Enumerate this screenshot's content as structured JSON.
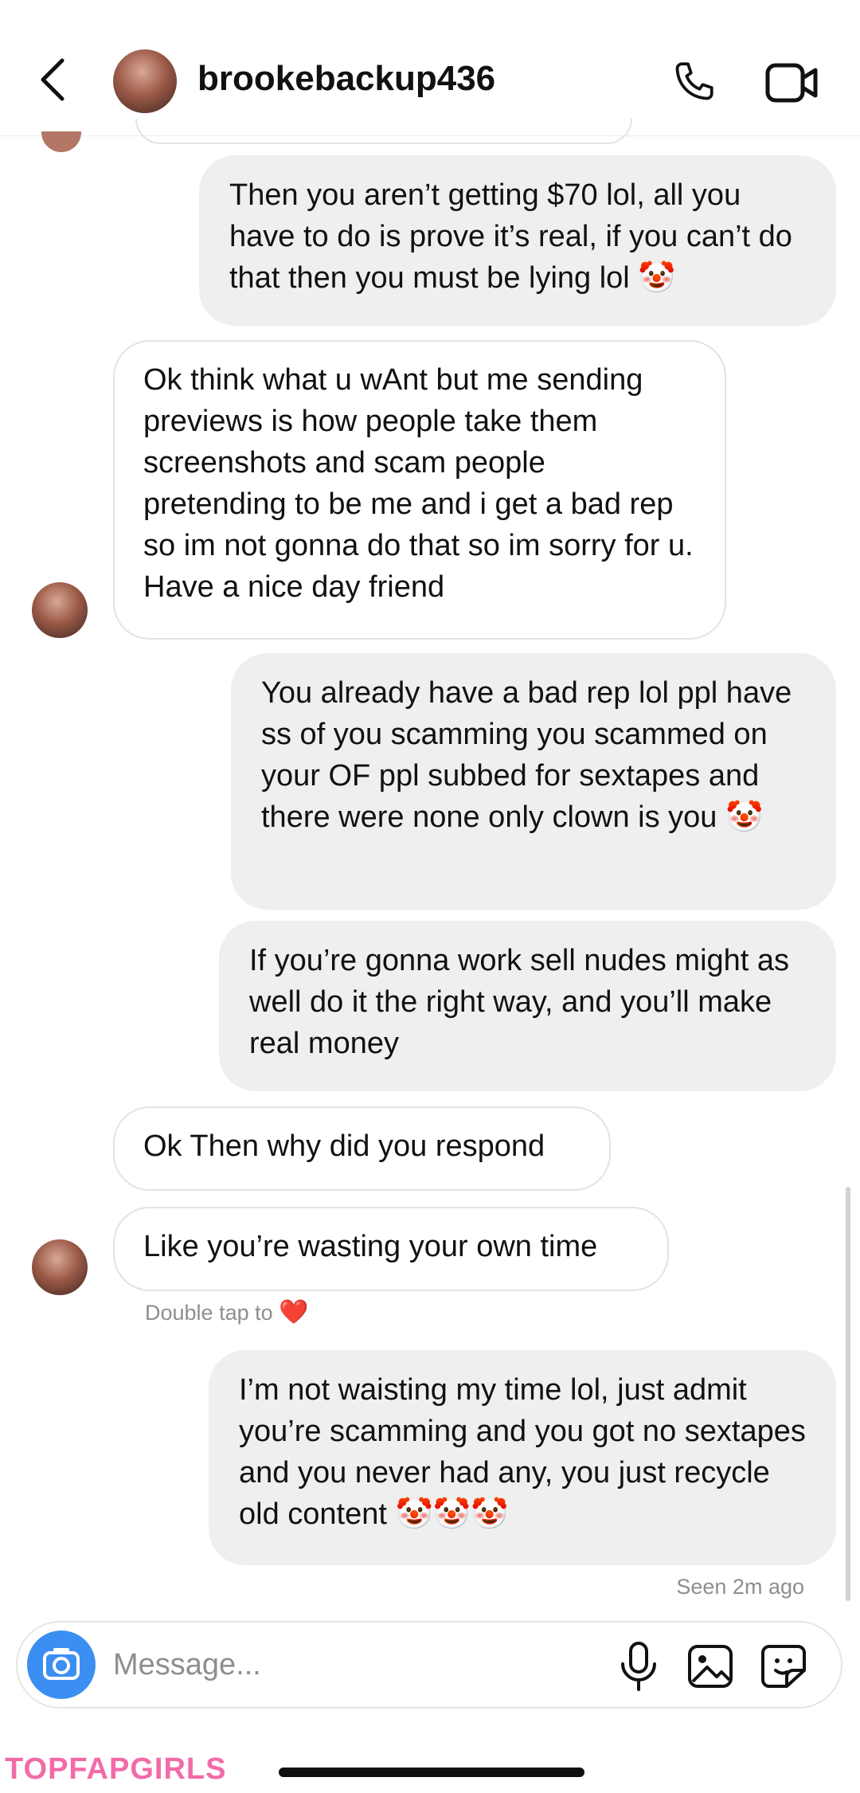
{
  "header": {
    "username": "brookebackup436"
  },
  "messages": [
    {
      "direction": "outgoing",
      "text": "Then you aren’t getting $70 lol, all you have to do is prove it’s real, if you can’t do that then you must be lying lol 🤡"
    },
    {
      "direction": "incoming",
      "text": "Ok think what u wAnt but me sending previews is how people take them screenshots and scam people pretending to be me and i get a bad rep so im not gonna do that so im sorry for u. Have a nice day friend"
    },
    {
      "direction": "outgoing",
      "text": "You already have a bad rep lol ppl have ss of you scamming you scammed on your OF ppl subbed for sextapes and there were none only clown is you 🤡"
    },
    {
      "direction": "outgoing",
      "text": "If you’re gonna work sell nudes might as well do it the right way, and you’ll make real money"
    },
    {
      "direction": "incoming",
      "text": "Ok Then why did you respond"
    },
    {
      "direction": "incoming",
      "text": "Like you’re wasting your own time"
    },
    {
      "direction": "outgoing",
      "text": "I’m not waisting my time lol, just admit you’re scamming and you got no sextapes and you never had any, you just recycle old content 🤡🤡🤡"
    }
  ],
  "reaction_hint": {
    "text": "Double tap to",
    "icon": "heart-icon",
    "emoji": "❤️"
  },
  "seen_status": "Seen 2m ago",
  "composer": {
    "placeholder": "Message..."
  },
  "watermark": "TOPFAPGIRLS",
  "colors": {
    "camera_button": "#3b8ff2",
    "outgoing_bubble": "#efefef",
    "watermark": "#f26ba8"
  }
}
